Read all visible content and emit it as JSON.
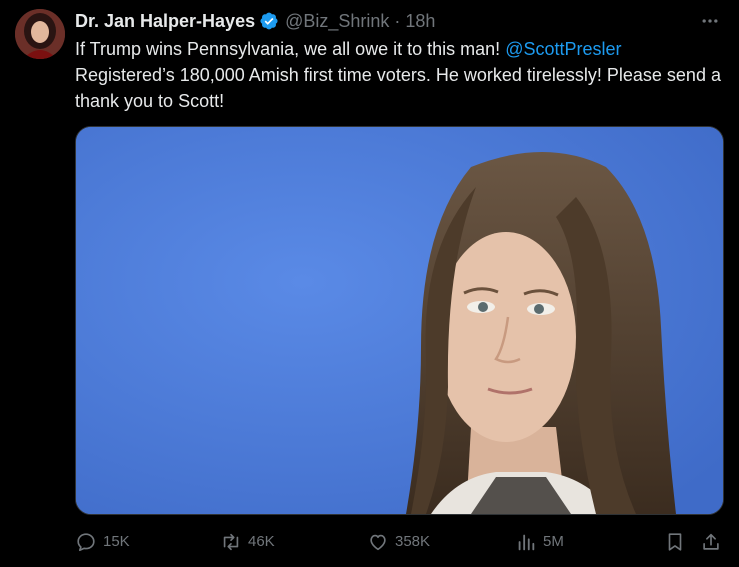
{
  "tweet": {
    "author_name": "Dr. Jan Halper-Hayes",
    "handle": "@Biz_Shrink",
    "separator": "·",
    "time": "18h",
    "text_part1": "If Trump wins Pennsylvania, we all owe it to this man! ",
    "mention": "@ScottPresler",
    "text_part2": " Registered’s 180,000 Amish first time voters. He worked tirelessly! Please send a thank you to Scott!"
  },
  "actions": {
    "replies": "15K",
    "reposts": "46K",
    "likes": "358K",
    "views": "5M"
  },
  "icons": {
    "verified": "verified-badge-icon",
    "more": "more-icon",
    "reply": "reply-icon",
    "repost": "repost-icon",
    "like": "heart-icon",
    "views": "views-icon",
    "bookmark": "bookmark-icon",
    "share": "share-icon"
  },
  "colors": {
    "background": "#000000",
    "text": "#e7e9ea",
    "muted": "#71767b",
    "accent": "#1d9bf0",
    "photo_background": "#4a7ad8"
  }
}
